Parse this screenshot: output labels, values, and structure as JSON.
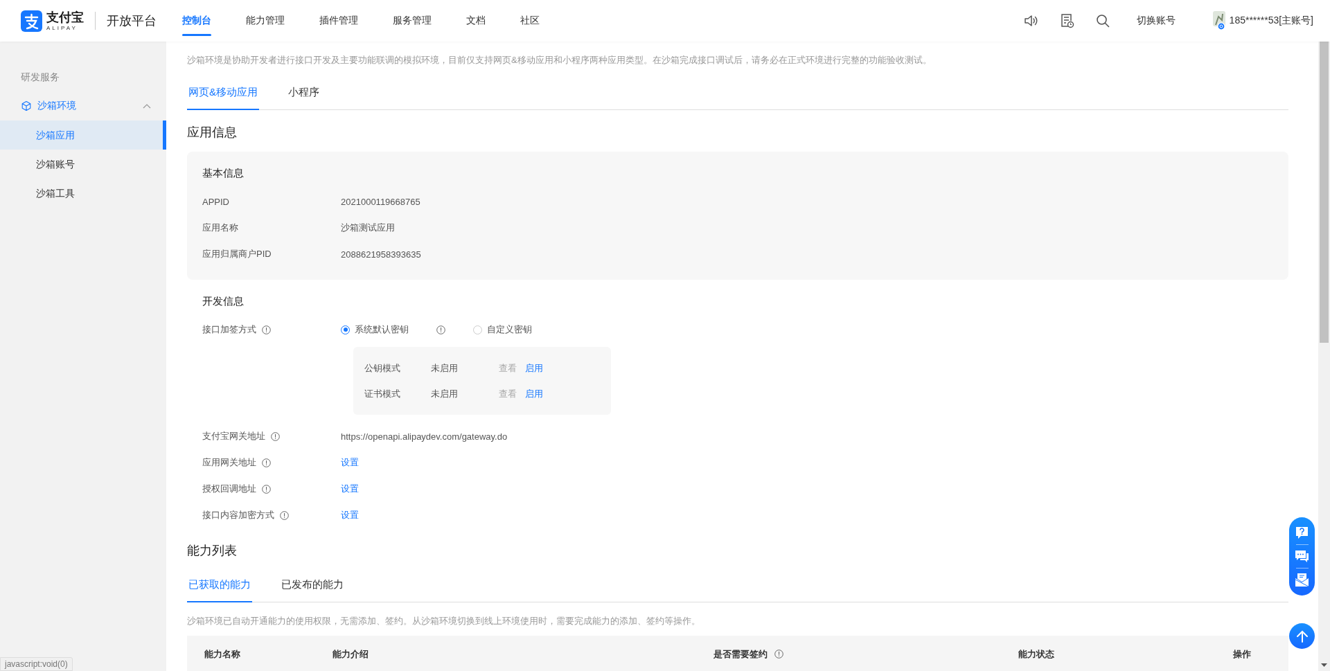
{
  "header": {
    "logo_text": "支付宝",
    "logo_sub": "ALIPAY",
    "platform": "开放平台",
    "nav": [
      {
        "label": "控制台",
        "selected": true
      },
      {
        "label": "能力管理",
        "selected": false
      },
      {
        "label": "插件管理",
        "selected": false
      },
      {
        "label": "服务管理",
        "selected": false
      },
      {
        "label": "文档",
        "selected": false
      },
      {
        "label": "社区",
        "selected": false
      }
    ],
    "switch_account": "切换账号",
    "user": "185******53[主账号]"
  },
  "sidebar": {
    "section": "研发服务",
    "group": {
      "label": "沙箱环境",
      "expanded": true,
      "children": [
        {
          "label": "沙箱应用",
          "selected": true
        },
        {
          "label": "沙箱账号",
          "selected": false
        },
        {
          "label": "沙箱工具",
          "selected": false
        }
      ]
    }
  },
  "page": {
    "description": "沙箱环境是协助开发者进行接口开发及主要功能联调的模拟环境，目前仅支持网页&移动应用和小程序两种应用类型。在沙箱完成接口调试后，请务必在正式环境进行完整的功能验收测试。",
    "tabs": [
      {
        "label": "网页&移动应用",
        "selected": true
      },
      {
        "label": "小程序",
        "selected": false
      }
    ],
    "app_info": {
      "title": "应用信息",
      "basic": {
        "title": "基本信息",
        "rows": [
          {
            "label": "APPID",
            "value": "2021000119668765"
          },
          {
            "label": "应用名称",
            "value": "沙箱测试应用"
          },
          {
            "label": "应用归属商户PID",
            "value": "2088621958393635"
          }
        ]
      },
      "dev": {
        "title": "开发信息",
        "sign": {
          "label": "接口加签方式",
          "options": [
            {
              "label": "系统默认密钥",
              "selected": true,
              "info": true
            },
            {
              "label": "自定义密钥",
              "selected": false,
              "info": false
            }
          ],
          "modes": [
            {
              "name": "公钥模式",
              "status": "未启用",
              "view": "查看",
              "enable": "启用"
            },
            {
              "name": "证书模式",
              "status": "未启用",
              "view": "查看",
              "enable": "启用"
            }
          ]
        },
        "rows": [
          {
            "label": "支付宝网关地址",
            "kind": "text",
            "value": "https://openapi.alipaydev.com/gateway.do"
          },
          {
            "label": "应用网关地址",
            "kind": "link",
            "value": "设置"
          },
          {
            "label": "授权回调地址",
            "kind": "link",
            "value": "设置"
          },
          {
            "label": "接口内容加密方式",
            "kind": "link",
            "value": "设置"
          }
        ]
      }
    },
    "abilities": {
      "title": "能力列表",
      "tabs": [
        {
          "label": "已获取的能力",
          "selected": true
        },
        {
          "label": "已发布的能力",
          "selected": false
        }
      ],
      "note": "沙箱环境已自动开通能力的使用权限，无需添加、签约。从沙箱环境切换到线上环境使用时，需要完成能力的添加、签约等操作。",
      "table": {
        "columns": [
          {
            "label": "能力名称",
            "info": false
          },
          {
            "label": "能力介绍",
            "info": false
          },
          {
            "label": "是否需要签约",
            "info": true
          },
          {
            "label": "能力状态",
            "info": false
          },
          {
            "label": "操作",
            "info": false
          }
        ]
      }
    }
  },
  "status_bar": "javascript:void(0)"
}
